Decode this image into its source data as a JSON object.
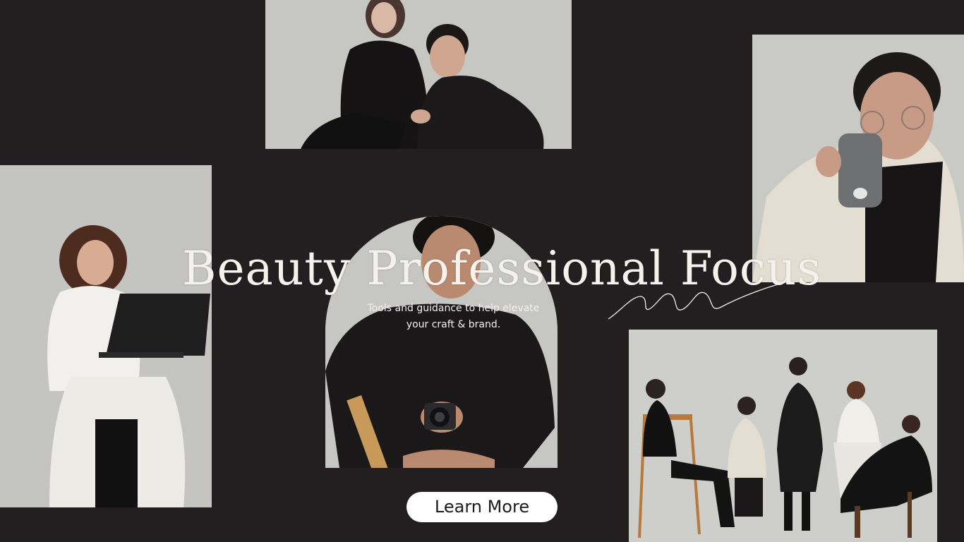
{
  "hero": {
    "title": "Beauty Professional Focus",
    "subtitle_line1": "Tools and guidance to help elevate",
    "subtitle_line2": "your craft & brand.",
    "cta_label": "Learn More"
  },
  "colors": {
    "background": "#231f20",
    "text": "#f5f2ee",
    "button_bg": "#ffffff",
    "button_text": "#1f1b1c"
  },
  "photos": [
    {
      "name": "photo-top-couple",
      "icon": "couple-portrait-image"
    },
    {
      "name": "photo-laptop",
      "icon": "woman-laptop-image"
    },
    {
      "name": "photo-mug",
      "icon": "man-mug-image"
    },
    {
      "name": "photo-camera",
      "icon": "woman-camera-image"
    },
    {
      "name": "photo-group",
      "icon": "group-portrait-image"
    }
  ]
}
